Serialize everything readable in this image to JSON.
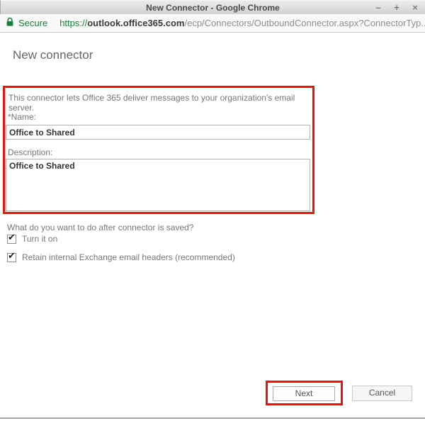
{
  "window": {
    "title": "New Connector - Google Chrome",
    "controls": {
      "minimize": "–",
      "maximize": "+",
      "close": "×"
    }
  },
  "browser": {
    "security_label": "Secure",
    "url_scheme": "https://",
    "url_domain": "outlook.office365.com",
    "url_path": "/ecp/Connectors/OutboundConnector.aspx?ConnectorTyp..."
  },
  "page": {
    "title": "New connector",
    "intro": "This connector lets Office 365 deliver messages to your organization's email server.",
    "name_label": "*Name:",
    "name_value": "Office to Shared",
    "description_label": "Description:",
    "description_value": "Office to Shared",
    "after_save_question": "What do you want to do after connector is saved?",
    "checkboxes": [
      {
        "label": "Turn it on",
        "checked": true,
        "check_glyph": "✔"
      },
      {
        "label": "Retain internal Exchange email headers (recommended)",
        "checked": true,
        "check_glyph": "✔"
      }
    ],
    "buttons": {
      "next": "Next",
      "cancel": "Cancel"
    }
  },
  "colors": {
    "secure_green": "#188038",
    "annotation_red": "#ee1111"
  }
}
